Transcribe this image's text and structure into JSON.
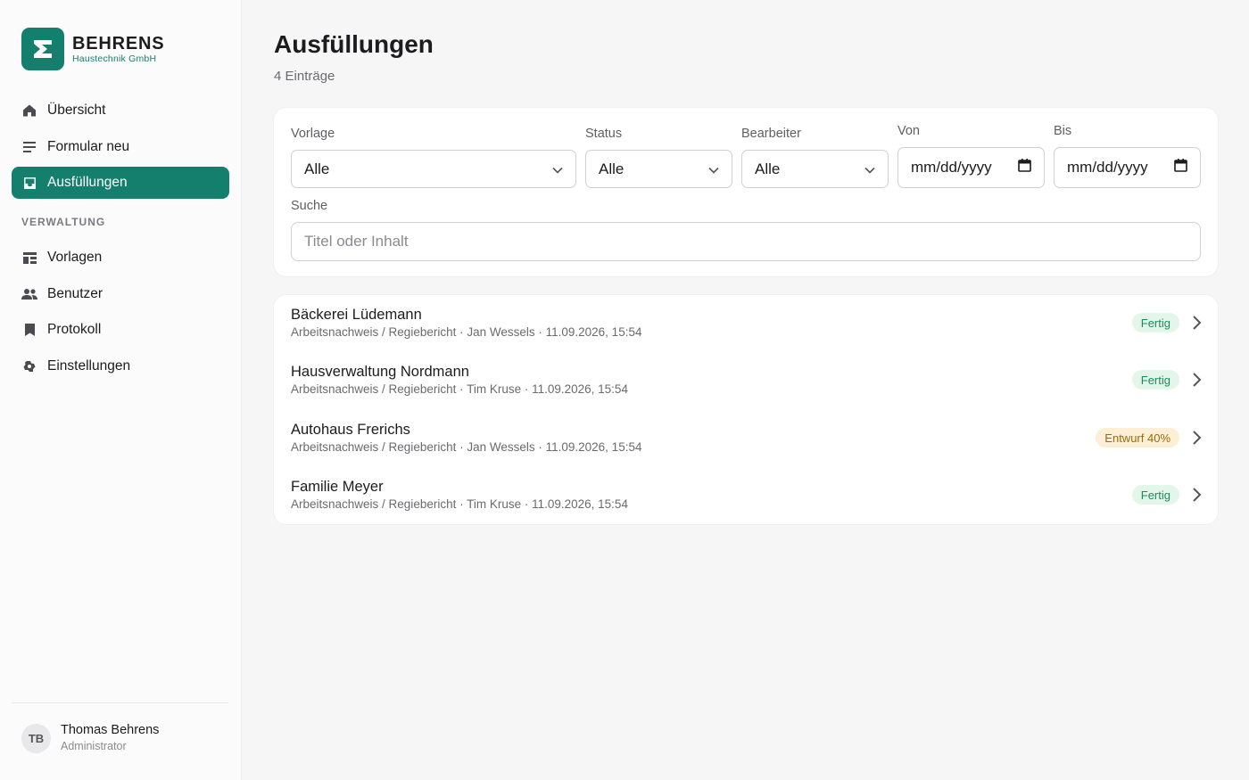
{
  "brand": {
    "name": "BEHRENS",
    "sub": "Haustechnik GmbH",
    "color": "#157f6d"
  },
  "nav": {
    "main": [
      {
        "label": "Übersicht",
        "icon": "home-icon",
        "active": false
      },
      {
        "label": "Formular neu",
        "icon": "list-icon",
        "active": false
      },
      {
        "label": "Ausfüllungen",
        "icon": "inbox-icon",
        "active": true
      }
    ],
    "section_label": "VERWALTUNG",
    "admin": [
      {
        "label": "Vorlagen",
        "icon": "template-icon"
      },
      {
        "label": "Benutzer",
        "icon": "users-icon"
      },
      {
        "label": "Protokoll",
        "icon": "bookmark-icon"
      },
      {
        "label": "Einstellungen",
        "icon": "settings-icon"
      }
    ]
  },
  "user": {
    "initials": "TB",
    "name": "Thomas Behrens",
    "role": "Administrator"
  },
  "page": {
    "title": "Ausfüllungen",
    "count": "4 Einträge"
  },
  "filters": {
    "vorlage": {
      "label": "Vorlage",
      "value": "Alle"
    },
    "status": {
      "label": "Status",
      "value": "Alle"
    },
    "bearbeiter": {
      "label": "Bearbeiter",
      "value": "Alle"
    },
    "von": {
      "label": "Von",
      "value": "mm/dd/yyyy"
    },
    "bis": {
      "label": "Bis",
      "value": "mm/dd/yyyy"
    },
    "suche": {
      "label": "Suche",
      "placeholder": "Titel oder Inhalt"
    }
  },
  "entries": [
    {
      "title": "Bäckerei Lüdemann",
      "meta": "Arbeitsnachweis / Regiebericht · Jan Wessels · 11.09.2026, 15:54",
      "status": "Fertig"
    },
    {
      "title": "Hausverwaltung Nordmann",
      "meta": "Arbeitsnachweis / Regiebericht · Tim Kruse · 11.09.2026, 15:54",
      "status": "Fertig"
    },
    {
      "title": "Autohaus Frerichs",
      "meta": "Arbeitsnachweis / Regiebericht · Jan Wessels · 11.09.2026, 15:54",
      "status": "Entwurf 40%"
    },
    {
      "title": "Familie Meyer",
      "meta": "Arbeitsnachweis / Regiebericht · Tim Kruse · 11.09.2026, 15:54",
      "status": "Fertig"
    }
  ]
}
